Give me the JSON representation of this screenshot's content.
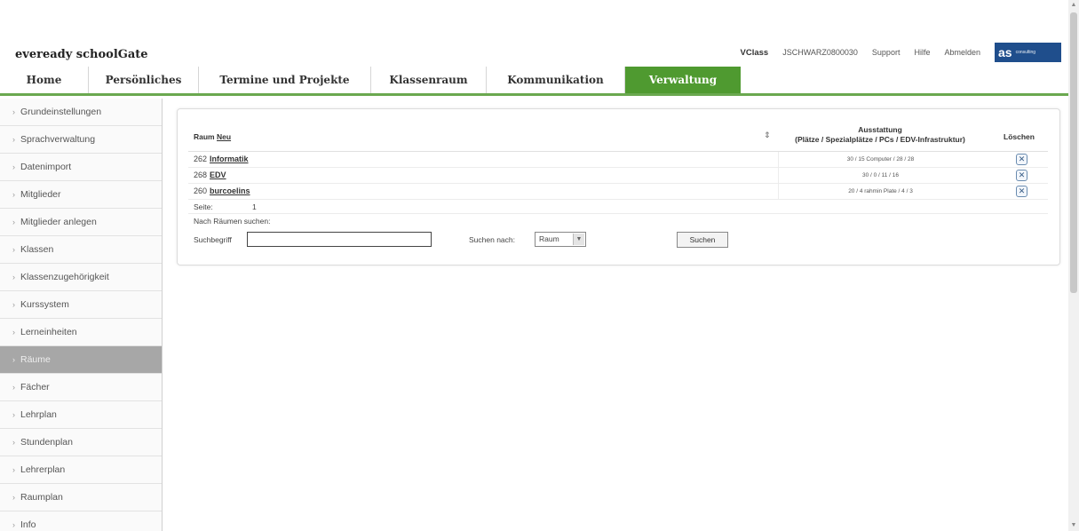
{
  "header": {
    "app_title": "eveready schoolGate",
    "vclass": "VClass",
    "user": "JSCHWARZ0800030",
    "support": "Support",
    "hilfe": "Hilfe",
    "abmelden": "Abmelden",
    "logo_text": "as",
    "logo_sub": "consulting"
  },
  "nav": {
    "tabs": [
      {
        "label": "Home"
      },
      {
        "label": "Persönliches"
      },
      {
        "label": "Termine und Projekte"
      },
      {
        "label": "Klassenraum"
      },
      {
        "label": "Kommunikation"
      },
      {
        "label": "Verwaltung"
      }
    ],
    "active": "Verwaltung"
  },
  "sidebar": {
    "items": [
      {
        "label": "Grundeinstellungen"
      },
      {
        "label": "Sprachverwaltung"
      },
      {
        "label": "Datenimport"
      },
      {
        "label": "Mitglieder"
      },
      {
        "label": "Mitglieder anlegen"
      },
      {
        "label": "Klassen"
      },
      {
        "label": "Klassenzugehörigkeit"
      },
      {
        "label": "Kurssystem"
      },
      {
        "label": "Lerneinheiten"
      },
      {
        "label": "Räume"
      },
      {
        "label": "Fächer"
      },
      {
        "label": "Lehrplan"
      },
      {
        "label": "Stundenplan"
      },
      {
        "label": "Lehrerplan"
      },
      {
        "label": "Raumplan"
      },
      {
        "label": "Info"
      }
    ],
    "active": "Räume"
  },
  "table": {
    "col_raum": "Raum",
    "col_raum_link": "Neu",
    "col_ausstattung_1": "Ausstattung",
    "col_ausstattung_2": "(Plätze / Spezialplätze / PCs / EDV-Infrastruktur)",
    "col_loeschen": "Löschen",
    "rows": [
      {
        "num": "262",
        "name": "Informatik",
        "ausstattung": "30 / 15 Computer / 28 / 28"
      },
      {
        "num": "268",
        "name": "EDV",
        "ausstattung": "30 / 0 / 11 / 16"
      },
      {
        "num": "260",
        "name": "burcoelins",
        "ausstattung": "20 / 4 rahmin Plate / 4 / 3"
      }
    ],
    "seite_label": "Seite:",
    "seite_value": "1"
  },
  "search": {
    "title": "Nach Räumen suchen:",
    "term_label": "Suchbegriff",
    "term_value": "",
    "by_label": "Suchen nach:",
    "by_selected": "Raum",
    "button_label": "Suchen"
  }
}
